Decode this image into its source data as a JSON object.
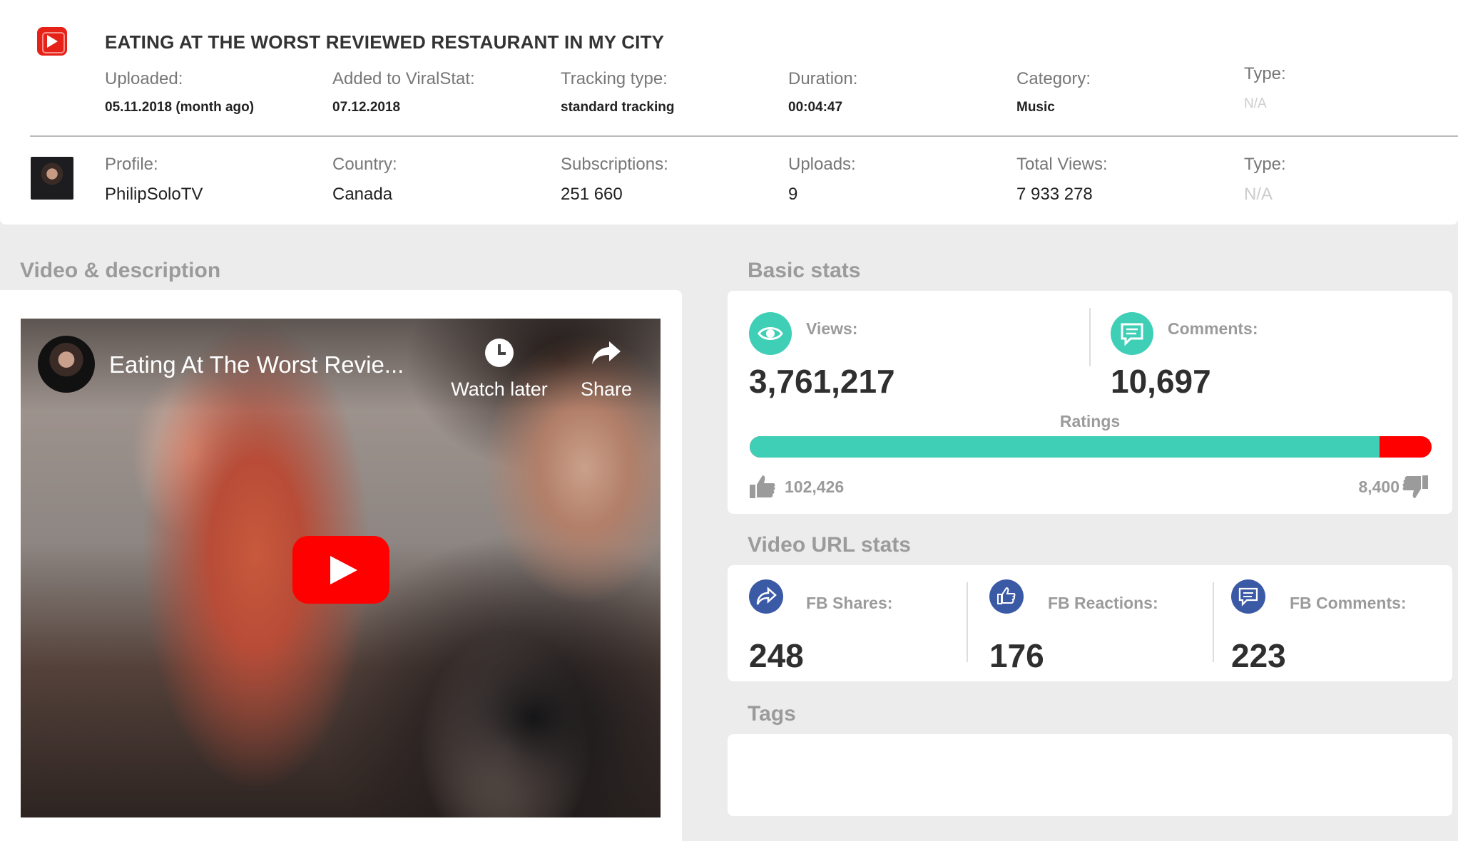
{
  "header": {
    "title": "EATING AT THE WORST REVIEWED RESTAURANT IN MY CITY",
    "meta": [
      {
        "label": "Uploaded:",
        "value": "05.11.2018 (month ago)"
      },
      {
        "label": "Added to ViralStat:",
        "value": "07.12.2018"
      },
      {
        "label": "Tracking type:",
        "value": "standard tracking"
      },
      {
        "label": "Duration:",
        "value": "00:04:47"
      },
      {
        "label": "Category:",
        "value": "Music"
      },
      {
        "label": "Type:",
        "value": "N/A"
      }
    ],
    "profile": [
      {
        "label": "Profile:",
        "value": "PhilipSoloTV"
      },
      {
        "label": "Country:",
        "value": "Canada"
      },
      {
        "label": "Subscriptions:",
        "value": "251 660"
      },
      {
        "label": "Uploads:",
        "value": "9"
      },
      {
        "label": "Total Views:",
        "value": "7 933 278"
      },
      {
        "label": "Type:",
        "value": "N/A"
      }
    ]
  },
  "video_section": {
    "title": "Video & description",
    "player": {
      "title": "Eating At The Worst Revie...",
      "watch_later": "Watch later",
      "share": "Share"
    }
  },
  "basic_stats": {
    "title": "Basic stats",
    "views_label": "Views:",
    "views": "3,761,217",
    "comments_label": "Comments:",
    "comments": "10,697",
    "ratings_label": "Ratings",
    "likes": "102,426",
    "dislikes": "8,400",
    "like_ratio": 0.924,
    "colors": {
      "likes": "#3ecfb6",
      "dislikes": "#ff0000"
    }
  },
  "url_stats": {
    "title": "Video URL stats",
    "items": [
      {
        "label": "FB Shares:",
        "value": "248",
        "icon": "share-arrow-icon"
      },
      {
        "label": "FB Reactions:",
        "value": "176",
        "icon": "thumbs-up-icon"
      },
      {
        "label": "FB Comments:",
        "value": "223",
        "icon": "comment-icon"
      }
    ]
  },
  "tags": {
    "title": "Tags"
  }
}
